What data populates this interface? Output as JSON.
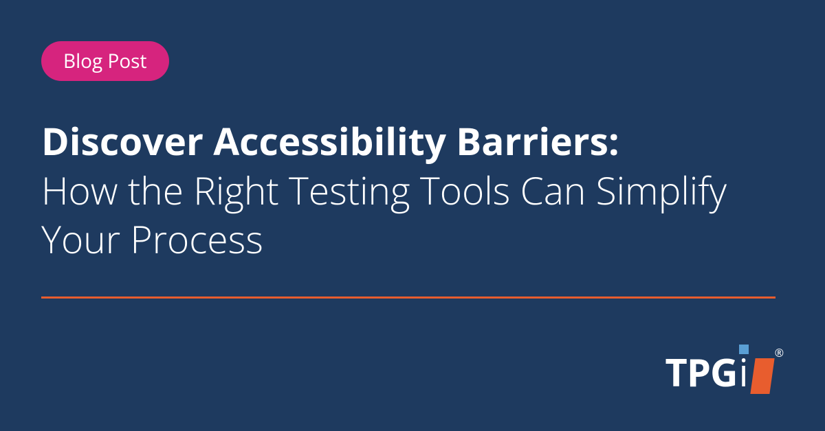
{
  "badge": {
    "label": "Blog Post"
  },
  "heading": {
    "bold": "Discover Accessibility Barriers:",
    "light": "How the Right Testing Tools Can Simplify Your Process"
  },
  "logo": {
    "main": "TPG",
    "suffix": "i",
    "registered": "®"
  },
  "colors": {
    "background": "#1e3a5f",
    "badge": "#d6247e",
    "accent": "#e85d2e",
    "text": "#ffffff",
    "logo_accent": "#5a9fd4"
  }
}
